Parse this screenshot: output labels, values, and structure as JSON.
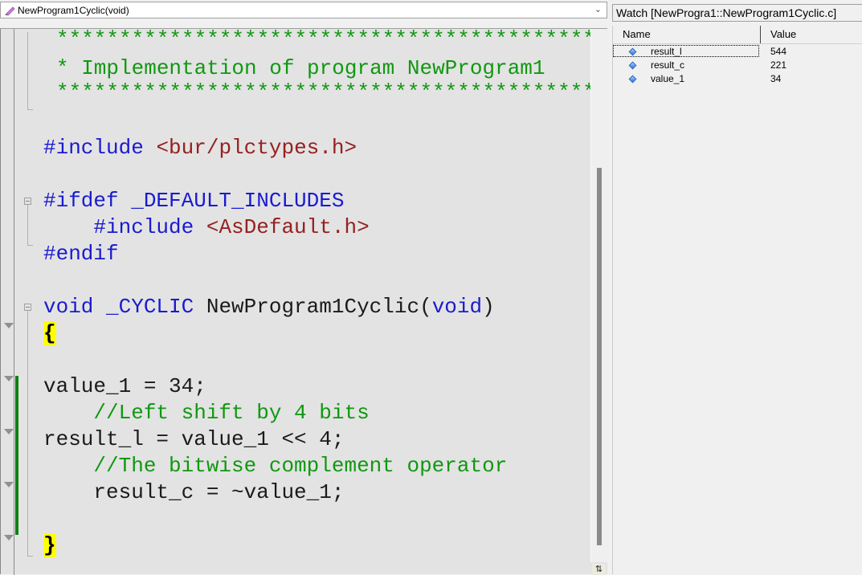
{
  "function_dropdown": {
    "selected": "NewProgram1Cyclic(void)",
    "icon": "pencil-icon"
  },
  "editor": {
    "lines": [
      {
        "id": "banner-top",
        "segments": [
          {
            "cls": "cm",
            "text": "*********************************************"
          }
        ]
      },
      {
        "id": "banner-title",
        "segments": [
          {
            "cls": "cm",
            "text": "* Implementation of program NewProgram1"
          }
        ]
      },
      {
        "id": "banner-bottom",
        "segments": [
          {
            "cls": "cm",
            "text": "*********************************************"
          }
        ]
      },
      {
        "id": "include-plctypes",
        "segments": [
          {
            "cls": "kw",
            "text": "#include "
          },
          {
            "cls": "str",
            "text": "<bur/plctypes.h>"
          }
        ]
      },
      {
        "id": "ifdef",
        "segments": [
          {
            "cls": "kw",
            "text": "#ifdef _DEFAULT_INCLUDES"
          }
        ]
      },
      {
        "id": "include-asdefault",
        "segments": [
          {
            "cls": "kw",
            "text": "    #include "
          },
          {
            "cls": "str",
            "text": "<AsDefault.h>"
          }
        ]
      },
      {
        "id": "endif",
        "segments": [
          {
            "cls": "kw",
            "text": "#endif"
          }
        ]
      },
      {
        "id": "func-signature",
        "segments": [
          {
            "cls": "kw",
            "text": "void _CYCLIC "
          },
          {
            "cls": "tx",
            "text": "NewProgram1Cyclic("
          },
          {
            "cls": "kw",
            "text": "void"
          },
          {
            "cls": "tx",
            "text": ")"
          }
        ]
      },
      {
        "id": "open-brace",
        "segments": [
          {
            "cls": "hl",
            "text": "{"
          }
        ]
      },
      {
        "id": "assign-value",
        "segments": [
          {
            "cls": "tx",
            "text": "value_1 = 34;"
          }
        ]
      },
      {
        "id": "comment-shift",
        "segments": [
          {
            "cls": "cm",
            "text": "    //Left shift by 4 bits"
          }
        ]
      },
      {
        "id": "assign-shift",
        "segments": [
          {
            "cls": "tx",
            "text": "result_l = value_1 << 4;"
          }
        ]
      },
      {
        "id": "comment-complement",
        "segments": [
          {
            "cls": "cm",
            "text": "    //The bitwise complement operator"
          }
        ]
      },
      {
        "id": "assign-complement",
        "segments": [
          {
            "cls": "tx",
            "text": "    result_c = ~value_1;"
          }
        ]
      },
      {
        "id": "close-brace",
        "segments": [
          {
            "cls": "hl",
            "text": "}"
          }
        ]
      }
    ]
  },
  "watch": {
    "title": "Watch [NewProgra1::NewProgram1Cyclic.c]",
    "columns": {
      "name": "Name",
      "value": "Value"
    },
    "rows": [
      {
        "name": "result_l",
        "value": "544",
        "icon": "variable-diamond-icon",
        "selected": true
      },
      {
        "name": "result_c",
        "value": "221",
        "icon": "variable-diamond-icon",
        "selected": false
      },
      {
        "name": "value_1",
        "value": "34",
        "icon": "variable-diamond-icon",
        "selected": false
      }
    ]
  },
  "colors": {
    "comment": "#109810",
    "keyword": "#1a1ad0",
    "string": "#962020",
    "brace_highlight": "#ffff00",
    "change_bar": "#108010"
  }
}
